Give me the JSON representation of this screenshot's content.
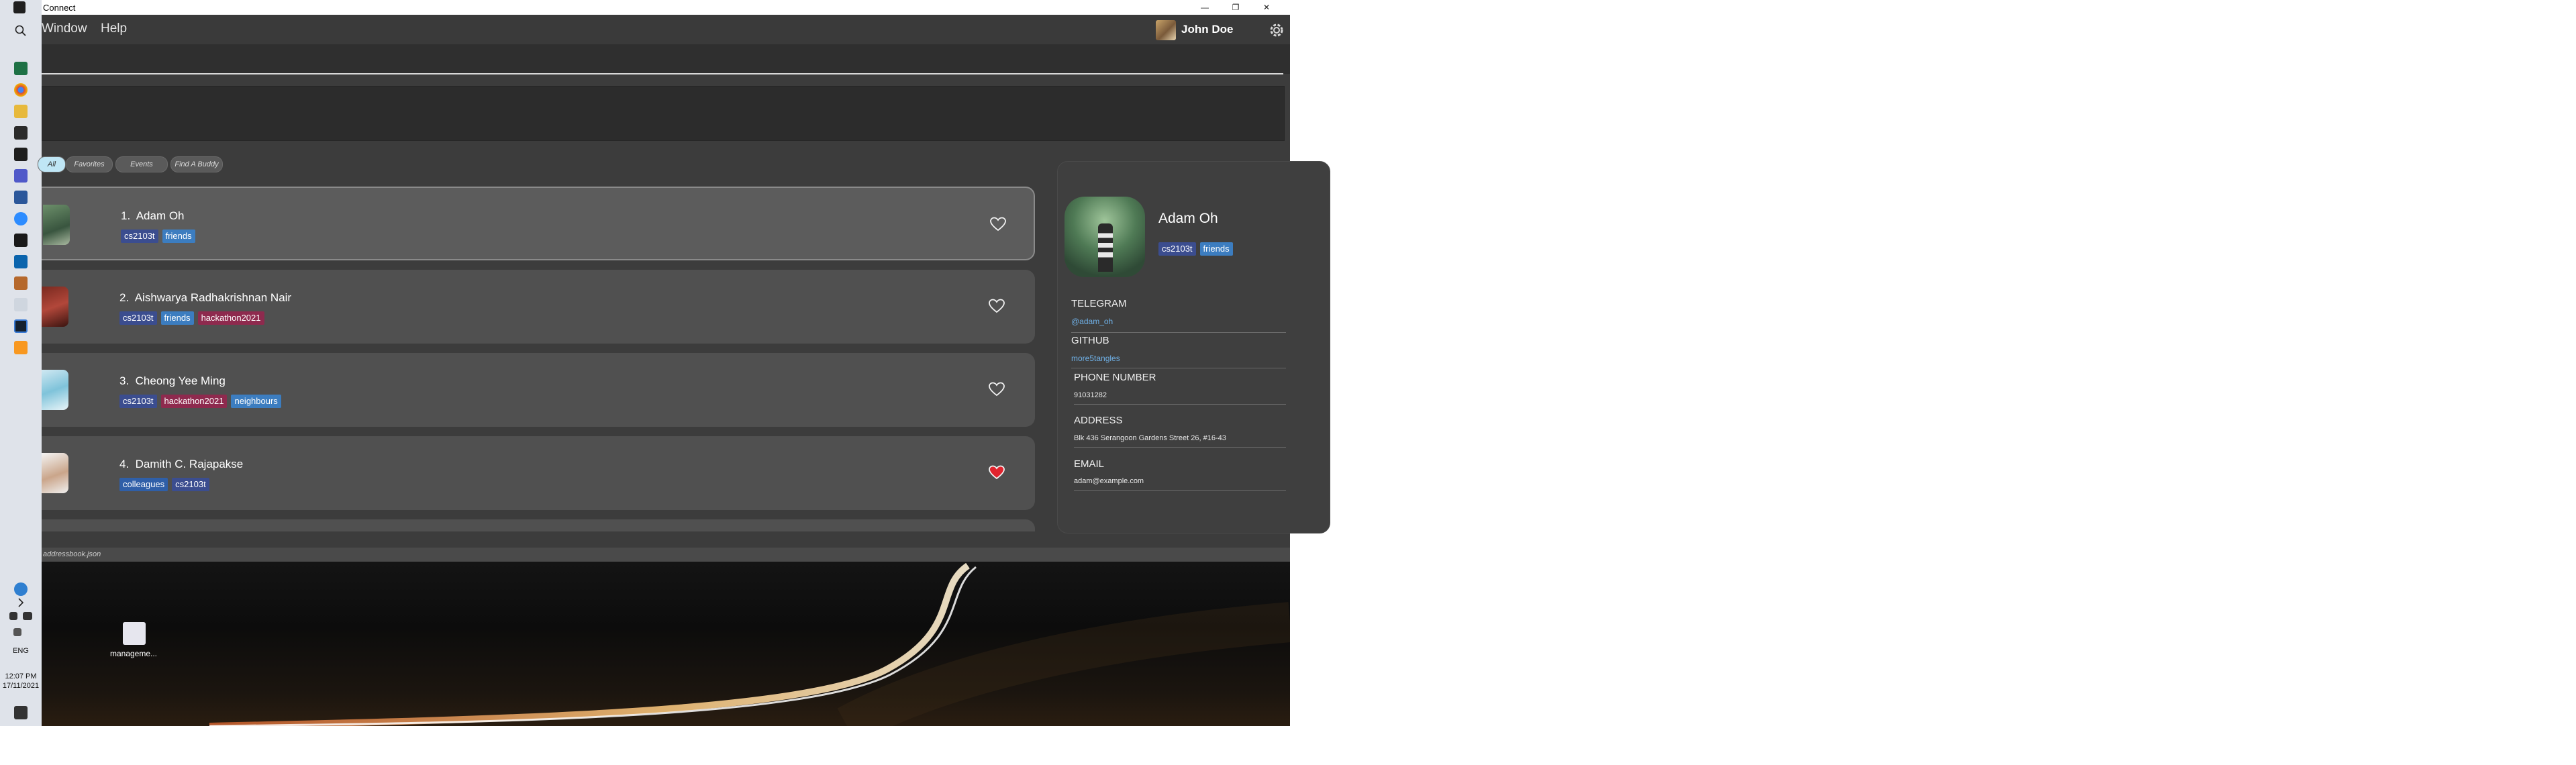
{
  "window": {
    "title": "Connect",
    "menu": [
      "Window",
      "Help"
    ],
    "user_name": "John Doe"
  },
  "tabs": [
    {
      "label": "All",
      "active": true
    },
    {
      "label": "Favorites",
      "active": false
    },
    {
      "label": "Events",
      "active": false
    },
    {
      "label": "Find A Buddy",
      "active": false
    }
  ],
  "persons": [
    {
      "index": "1.",
      "name": "Adam Oh",
      "favorite": false,
      "selected": true,
      "tags": [
        {
          "text": "cs2103t",
          "color": "#3b4d8f"
        },
        {
          "text": "friends",
          "color": "#3c7dc0"
        }
      ]
    },
    {
      "index": "2.",
      "name": "Aishwarya Radhakrishnan Nair",
      "favorite": false,
      "selected": false,
      "tags": [
        {
          "text": "cs2103t",
          "color": "#3b4d8f"
        },
        {
          "text": "friends",
          "color": "#3c7dc0"
        },
        {
          "text": "hackathon2021",
          "color": "#8e2a4e"
        }
      ]
    },
    {
      "index": "3.",
      "name": "Cheong Yee Ming",
      "favorite": false,
      "selected": false,
      "tags": [
        {
          "text": "cs2103t",
          "color": "#3b4d8f"
        },
        {
          "text": "hackathon2021",
          "color": "#8e2a4e"
        },
        {
          "text": "neighbours",
          "color": "#3c7dc0"
        }
      ]
    },
    {
      "index": "4.",
      "name": "Damith C. Rajapakse",
      "favorite": true,
      "selected": false,
      "tags": [
        {
          "text": "colleagues",
          "color": "#2f5fa8"
        },
        {
          "text": "cs2103t",
          "color": "#3b4d8f"
        }
      ]
    }
  ],
  "detail": {
    "name": "Adam Oh",
    "tags": [
      {
        "text": "cs2103t",
        "color": "#3b4d8f"
      },
      {
        "text": "friends",
        "color": "#3c7dc0"
      }
    ],
    "telegram_label": "TELEGRAM",
    "telegram": "@adam_oh",
    "github_label": "GITHUB",
    "github": "more5tangles",
    "phone_label": "PHONE NUMBER",
    "phone": "91031282",
    "address_label": "ADDRESS",
    "address": "Blk 436 Serangoon Gardens Street 26, #16-43",
    "email_label": "EMAIL",
    "email": "adam@example.com"
  },
  "statusbar": {
    "path": "addressbook.json"
  },
  "desktop": {
    "icon_label": "manageme..."
  },
  "taskbar": {
    "language": "ENG",
    "time": "12:07 PM",
    "date": "17/11/2021"
  },
  "colors": {
    "heart_active": "#e0242e",
    "accent_tab": "#bfe6f5"
  }
}
